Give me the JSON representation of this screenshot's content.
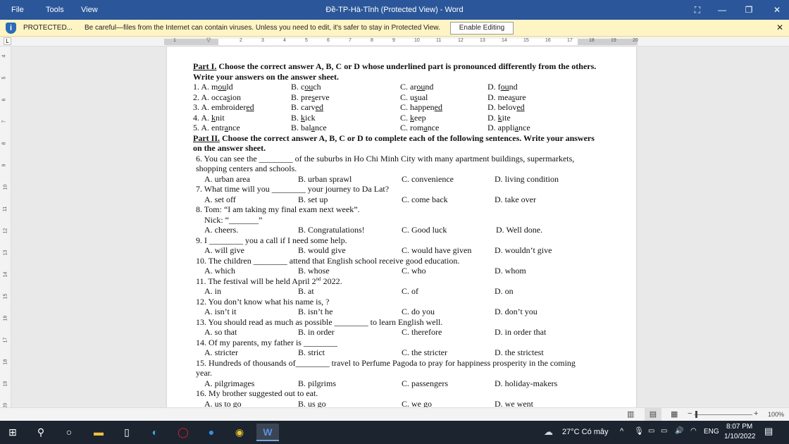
{
  "titlebar": {
    "menu": [
      "File",
      "Tools",
      "View"
    ],
    "title": "Đề-TP-Hà-Tĩnh (Protected View) - Word"
  },
  "protected": {
    "label": "PROTECTED...",
    "message": "Be careful—files from the Internet can contain viruses. Unless you need to edit, it's safer to stay in Protected View.",
    "button": "Enable Editing"
  },
  "ruler": {
    "top_labels": [
      "1",
      "2",
      "3",
      "4",
      "5",
      "6",
      "7",
      "8",
      "9",
      "10",
      "11",
      "12",
      "13",
      "14",
      "15",
      "16",
      "17",
      "18",
      "19",
      "20"
    ],
    "left_labels": [
      "4",
      "5",
      "6",
      "7",
      "8",
      "9",
      "10",
      "11",
      "12",
      "13",
      "14",
      "15",
      "16",
      "17",
      "18",
      "19",
      "20"
    ]
  },
  "doc": {
    "part1_title": "Part I.",
    "part1_text": " Choose the correct answer A, B, C or D whose underlined part is pronounced differently from the others.",
    "part1_text2": "Write your answers on the answer sheet.",
    "part1_items": [
      [
        [
          "1. A. m",
          "ou",
          "ld"
        ],
        [
          "B. c",
          "ou",
          "ch"
        ],
        [
          "C. ar",
          "ou",
          "nd"
        ],
        [
          "D. f",
          "ou",
          "nd"
        ]
      ],
      [
        [
          "2. A. occa",
          "s",
          "ion"
        ],
        [
          "B. pre",
          "s",
          "erve"
        ],
        [
          "C. u",
          "s",
          "ual"
        ],
        [
          "D. mea",
          "s",
          "ure"
        ]
      ],
      [
        [
          "3. A. embroider",
          "ed",
          ""
        ],
        [
          "B. carv",
          "ed",
          ""
        ],
        [
          "C. happen",
          "ed",
          ""
        ],
        [
          "D. belov",
          "ed",
          ""
        ]
      ],
      [
        [
          "4. A. ",
          "k",
          "nit"
        ],
        [
          "B. ",
          "k",
          "ick"
        ],
        [
          "C. ",
          "k",
          "eep"
        ],
        [
          "D. ",
          "k",
          "ite"
        ]
      ],
      [
        [
          "5. A. entr",
          "a",
          "nce"
        ],
        [
          "B. bal",
          "a",
          "nce"
        ],
        [
          "C. rom",
          "a",
          "nce"
        ],
        [
          "D. appli",
          "a",
          "nce"
        ]
      ]
    ],
    "part2_title": "Part II.",
    "part2_text": " Choose the correct answer A, B, C or D to complete each of the following sentences. Write your answers",
    "part2_text2": "on the answer sheet.",
    "part2_items": [
      {
        "q": [
          "6. You can see the ________ of the suburbs in Ho Chi Minh City with many apartment buildings, supermarkets,",
          "shopping centers and schools."
        ],
        "o": [
          "A. urban area",
          "B. urban sprawl",
          "C. convenience",
          "D. living condition"
        ]
      },
      {
        "q": [
          "7. What time will you ________ your journey to Da Lat?"
        ],
        "o": [
          "A. set off",
          "B. set up",
          "C. come back",
          "D. take over"
        ]
      },
      {
        "q": [
          "8. Tom: “I am taking my final exam next week”."
        ],
        "q2": "Nick: “_______”",
        "o": [
          "A. cheers.",
          "B. Congratulations!",
          "C. Good luck",
          "D. Well done."
        ]
      },
      {
        "q": [
          "9. I ________ you a call if I need some help."
        ],
        "o": [
          "A. will give",
          "B. would give",
          "C. would have given",
          "D. wouldn’t give"
        ]
      },
      {
        "q": [
          "10. The children ________ attend that English school receive good education."
        ],
        "o": [
          "A. which",
          "B. whose",
          "C. who",
          "D. whom"
        ]
      },
      {
        "q": [
          "11. The festival will be held                   April 2"
        ],
        "sup": "nd",
        "post": " 2022.",
        "o": [
          "A. in",
          "B. at",
          "C. of",
          "D. on"
        ]
      },
      {
        "q": [
          "12. You don’t know what his name is,                  ?"
        ],
        "o": [
          "A. isn’t it",
          "B. isn’t he",
          "C. do you",
          "D. don’t you"
        ]
      },
      {
        "q": [
          "13. You should read as much as possible ________ to learn English well."
        ],
        "o": [
          "A. so that",
          "B. in order",
          "C. therefore",
          "D. in order that"
        ]
      },
      {
        "q": [
          "14. Of my parents, my father is ________"
        ],
        "o": [
          "A. stricter",
          "B. strict",
          "C. the stricter",
          "D. the strictest"
        ]
      },
      {
        "q": [
          "15. Hundreds of thousands of________ travel to Perfume Pagoda to pray for happiness prosperity in the coming",
          "year."
        ],
        "o": [
          "A. pilgrimages",
          "B. pilgrims",
          "C. passengers",
          "D. holiday-makers"
        ]
      },
      {
        "q": [
          "16. My brother suggested                   out to eat."
        ],
        "o": [
          "A. us to go",
          "B. us go",
          "C. we go",
          "D. we went"
        ]
      }
    ]
  },
  "statusbar": {
    "zoom": "100%",
    "zoom_level_percent": 100
  },
  "taskbar": {
    "weather": "27°C  Có mây",
    "lang": "ENG",
    "time": "8:07 PM",
    "date": "1/10/2022",
    "apps": [
      "start-icon",
      "search-icon",
      "cortana-icon",
      "file-explorer-icon",
      "file-icon",
      "edge-icon",
      "opera-icon",
      "zalo-icon",
      "chrome-icon",
      "word-icon"
    ]
  },
  "colors": {
    "titlebar": "#2b579a",
    "protected_bar": "#fff4c4",
    "taskbar": "#1c2430"
  }
}
